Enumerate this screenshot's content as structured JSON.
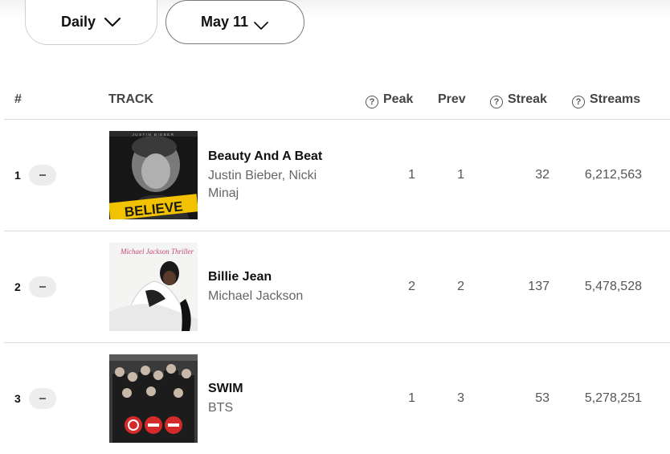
{
  "filters": {
    "period": "Daily",
    "date": "May 11"
  },
  "header": {
    "rank": "#",
    "track": "TRACK",
    "peak": "Peak",
    "prev": "Prev",
    "streak": "Streak",
    "streams": "Streams"
  },
  "help_glyph": "?",
  "rows": [
    {
      "rank": "1",
      "title": "Beauty And A Beat",
      "artist": "Justin Bieber, Nicki Minaj",
      "peak": "1",
      "prev": "1",
      "streak": "32",
      "streams": "6,212,563",
      "art_text": "BELIEVE",
      "art_top": "JUSTIN BIEBER"
    },
    {
      "rank": "2",
      "title": "Billie Jean",
      "artist": "Michael Jackson",
      "peak": "2",
      "prev": "2",
      "streak": "137",
      "streams": "5,478,528",
      "art_text": "Michael Jackson Thriller"
    },
    {
      "rank": "3",
      "title": "SWIM",
      "artist": "BTS",
      "peak": "1",
      "prev": "3",
      "streak": "53",
      "streams": "5,278,251"
    }
  ],
  "icons": {
    "chevron": "chevron-down-icon",
    "help": "help-icon",
    "no_change": "no-change-icon"
  },
  "colors": {
    "text": "#111111",
    "muted": "#666666",
    "divider": "#dcdcdc",
    "badge": "#ededed",
    "believe_yellow": "#f2c200"
  }
}
